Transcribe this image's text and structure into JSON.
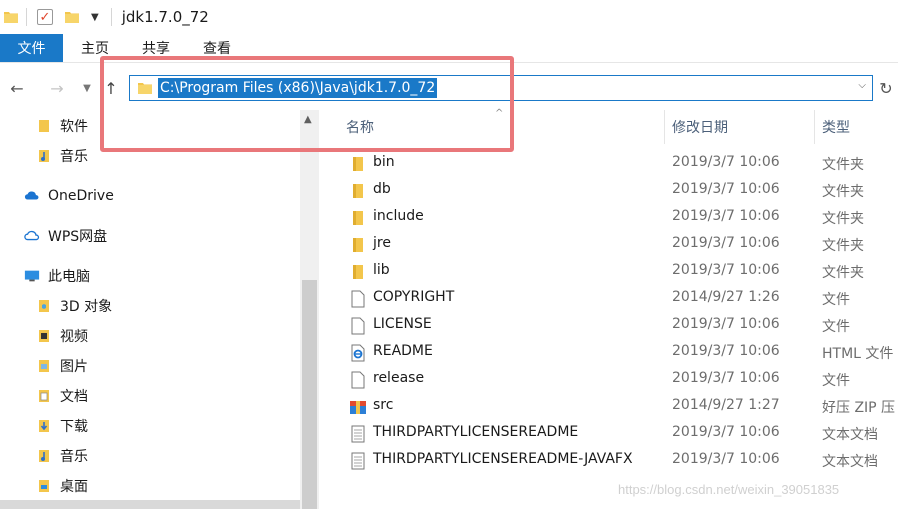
{
  "window": {
    "title": "jdk1.7.0_72"
  },
  "ribbon": {
    "tabs": [
      "文件",
      "主页",
      "共享",
      "查看"
    ]
  },
  "address": {
    "path": "C:\\Program Files (x86)\\Java\\jdk1.7.0_72"
  },
  "sidebar": {
    "items": [
      {
        "label": "软件",
        "icon": "folder-icon"
      },
      {
        "label": "音乐",
        "icon": "music-folder-icon"
      },
      {
        "label": "OneDrive",
        "icon": "cloud-icon"
      },
      {
        "label": "WPS网盘",
        "icon": "wps-cloud-icon"
      },
      {
        "label": "此电脑",
        "icon": "computer-icon"
      },
      {
        "label": "3D 对象",
        "icon": "3d-objects-icon"
      },
      {
        "label": "视频",
        "icon": "video-folder-icon"
      },
      {
        "label": "图片",
        "icon": "pictures-folder-icon"
      },
      {
        "label": "文档",
        "icon": "documents-folder-icon"
      },
      {
        "label": "下载",
        "icon": "download-folder-icon"
      },
      {
        "label": "音乐",
        "icon": "music-folder-icon"
      },
      {
        "label": "桌面",
        "icon": "desktop-folder-icon"
      }
    ]
  },
  "columns": {
    "name": "名称",
    "date": "修改日期",
    "type": "类型"
  },
  "files": [
    {
      "name": "bin",
      "date": "2019/3/7 10:06",
      "type": "文件夹",
      "icon": "folder-icon"
    },
    {
      "name": "db",
      "date": "2019/3/7 10:06",
      "type": "文件夹",
      "icon": "folder-icon"
    },
    {
      "name": "include",
      "date": "2019/3/7 10:06",
      "type": "文件夹",
      "icon": "folder-icon"
    },
    {
      "name": "jre",
      "date": "2019/3/7 10:06",
      "type": "文件夹",
      "icon": "folder-icon"
    },
    {
      "name": "lib",
      "date": "2019/3/7 10:06",
      "type": "文件夹",
      "icon": "folder-icon"
    },
    {
      "name": "COPYRIGHT",
      "date": "2014/9/27 1:26",
      "type": "文件",
      "icon": "file-icon"
    },
    {
      "name": "LICENSE",
      "date": "2019/3/7 10:06",
      "type": "文件",
      "icon": "file-icon"
    },
    {
      "name": "README",
      "date": "2019/3/7 10:06",
      "type": "HTML 文件",
      "icon": "html-file-icon"
    },
    {
      "name": "release",
      "date": "2019/3/7 10:06",
      "type": "文件",
      "icon": "file-icon"
    },
    {
      "name": "src",
      "date": "2014/9/27 1:27",
      "type": "好压 ZIP 压",
      "icon": "zip-archive-icon"
    },
    {
      "name": "THIRDPARTYLICENSEREADME",
      "date": "2019/3/7 10:06",
      "type": "文本文档",
      "icon": "text-file-icon"
    },
    {
      "name": "THIRDPARTYLICENSEREADME-JAVAFX",
      "date": "2019/3/7 10:06",
      "type": "文本文档",
      "icon": "text-file-icon"
    }
  ],
  "watermark": "https://blog.csdn.net/weixin_39051835",
  "colors": {
    "accent": "#1a79c8",
    "highlight": "#e9777a",
    "folder": "#f3c64c"
  }
}
